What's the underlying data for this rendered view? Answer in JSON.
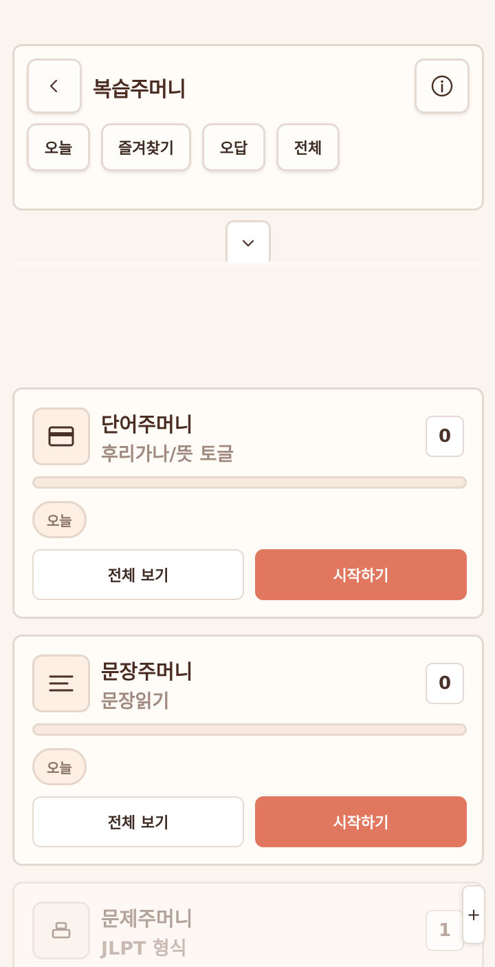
{
  "header": {
    "title": "복습주머니",
    "filters": [
      "오늘",
      "즐겨찾기",
      "오답",
      "전체"
    ]
  },
  "pouches": [
    {
      "title": "단어주머니",
      "subtitle": "후리가나/뜻 토글",
      "count": "0",
      "progress": 0,
      "tag": "오늘",
      "view_all_label": "전체 보기",
      "start_label": "시작하기",
      "icon": "card-icon"
    },
    {
      "title": "문장주머니",
      "subtitle": "문장읽기",
      "count": "0",
      "progress": 0,
      "tag": "오늘",
      "view_all_label": "전체 보기",
      "start_label": "시작하기",
      "icon": "lines-icon"
    },
    {
      "title": "문제주머니",
      "subtitle": "JLPT 형식",
      "count": "1",
      "icon": "printer-icon"
    }
  ],
  "side_tab": {
    "label": "+"
  },
  "colors": {
    "accent": "#e2775f",
    "background": "#fcf4ee",
    "card": "#fffcf8"
  }
}
